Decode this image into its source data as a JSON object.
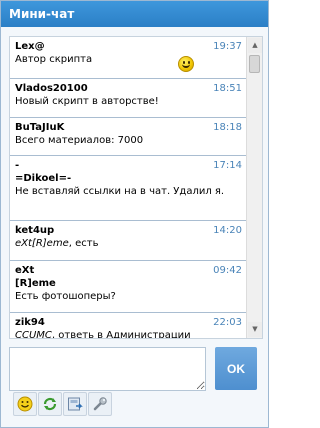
{
  "widget": {
    "title": "Мини-чат"
  },
  "messages": [
    {
      "user": "Lex@",
      "time": "19:37",
      "text": "Автор скрипта",
      "has_smiley": true
    },
    {
      "user": "Vlados20100",
      "time": "18:51",
      "text": "Новый скрипт в авторстве!"
    },
    {
      "user": "BuTaJIuK",
      "time": "18:18",
      "text": "Всего материалов: 7000"
    },
    {
      "user": "-",
      "time": "17:14",
      "user_line2": "=Dikoel=-",
      "text": "Не вставляй ссылки на в чат. Удалил я."
    },
    {
      "user": "ket4up",
      "time": "14:20",
      "text_em": "eXt[R]eme",
      "text": ", есть"
    },
    {
      "user": "eXt",
      "time": "09:42",
      "user_line2": "[R]eme",
      "text": "Есть фотошоперы?"
    },
    {
      "user": "zik94",
      "time": "22:03",
      "text_em": "CCUMC",
      "text": ", ответь в Администрации"
    }
  ],
  "input": {
    "button_label": "OK"
  },
  "toolbar": {
    "buttons": [
      {
        "icon": "smiley-icon"
      },
      {
        "icon": "refresh-icon"
      },
      {
        "icon": "save-icon"
      },
      {
        "icon": "wrench-icon"
      }
    ]
  }
}
